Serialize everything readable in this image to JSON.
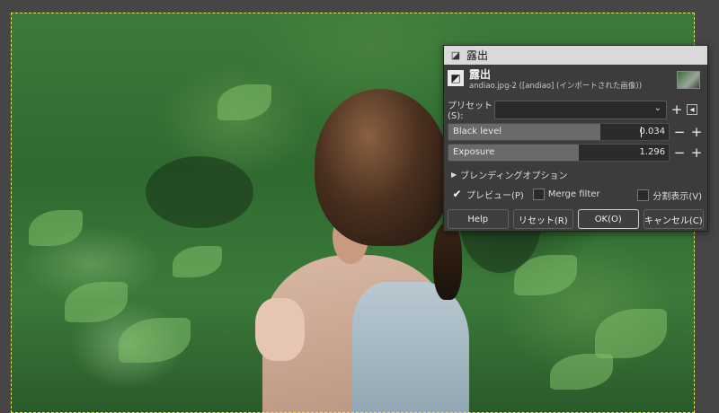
{
  "dialog": {
    "title": "露出",
    "filter_name": "露出",
    "image_name": "andiao.jpg-2 ([andiao] (インポートされた画像))",
    "preset": {
      "label": "プリセット(S):",
      "value": ""
    },
    "sliders": [
      {
        "label": "Black level",
        "value": "0.034",
        "fill_fraction": 0.69
      },
      {
        "label": "Exposure",
        "value": "1.296",
        "fill_fraction": 0.59
      }
    ],
    "blending": {
      "label": "ブレンディングオプション"
    },
    "preview": {
      "label": "プレビュー(P)",
      "checked": true
    },
    "merge": {
      "label": "Merge filter",
      "checked": false
    },
    "split": {
      "label": "分割表示(V)",
      "checked": false
    },
    "buttons": {
      "help": "Help",
      "reset": "リセット(R)",
      "ok": "OK(O)",
      "cancel": "キャンセル(C)"
    }
  },
  "icons": {
    "title": "exposure-filter-icon",
    "filter": "exposure-filter-icon",
    "add_preset": "plus-icon",
    "manage_preset": "menu-triangle-icon",
    "decrease": "minus-icon",
    "increase": "plus-icon"
  },
  "colors": {
    "dialog_bg": "#3c3c3c",
    "titlebar_bg": "#d9d9d9",
    "selection": "#e8e060"
  }
}
